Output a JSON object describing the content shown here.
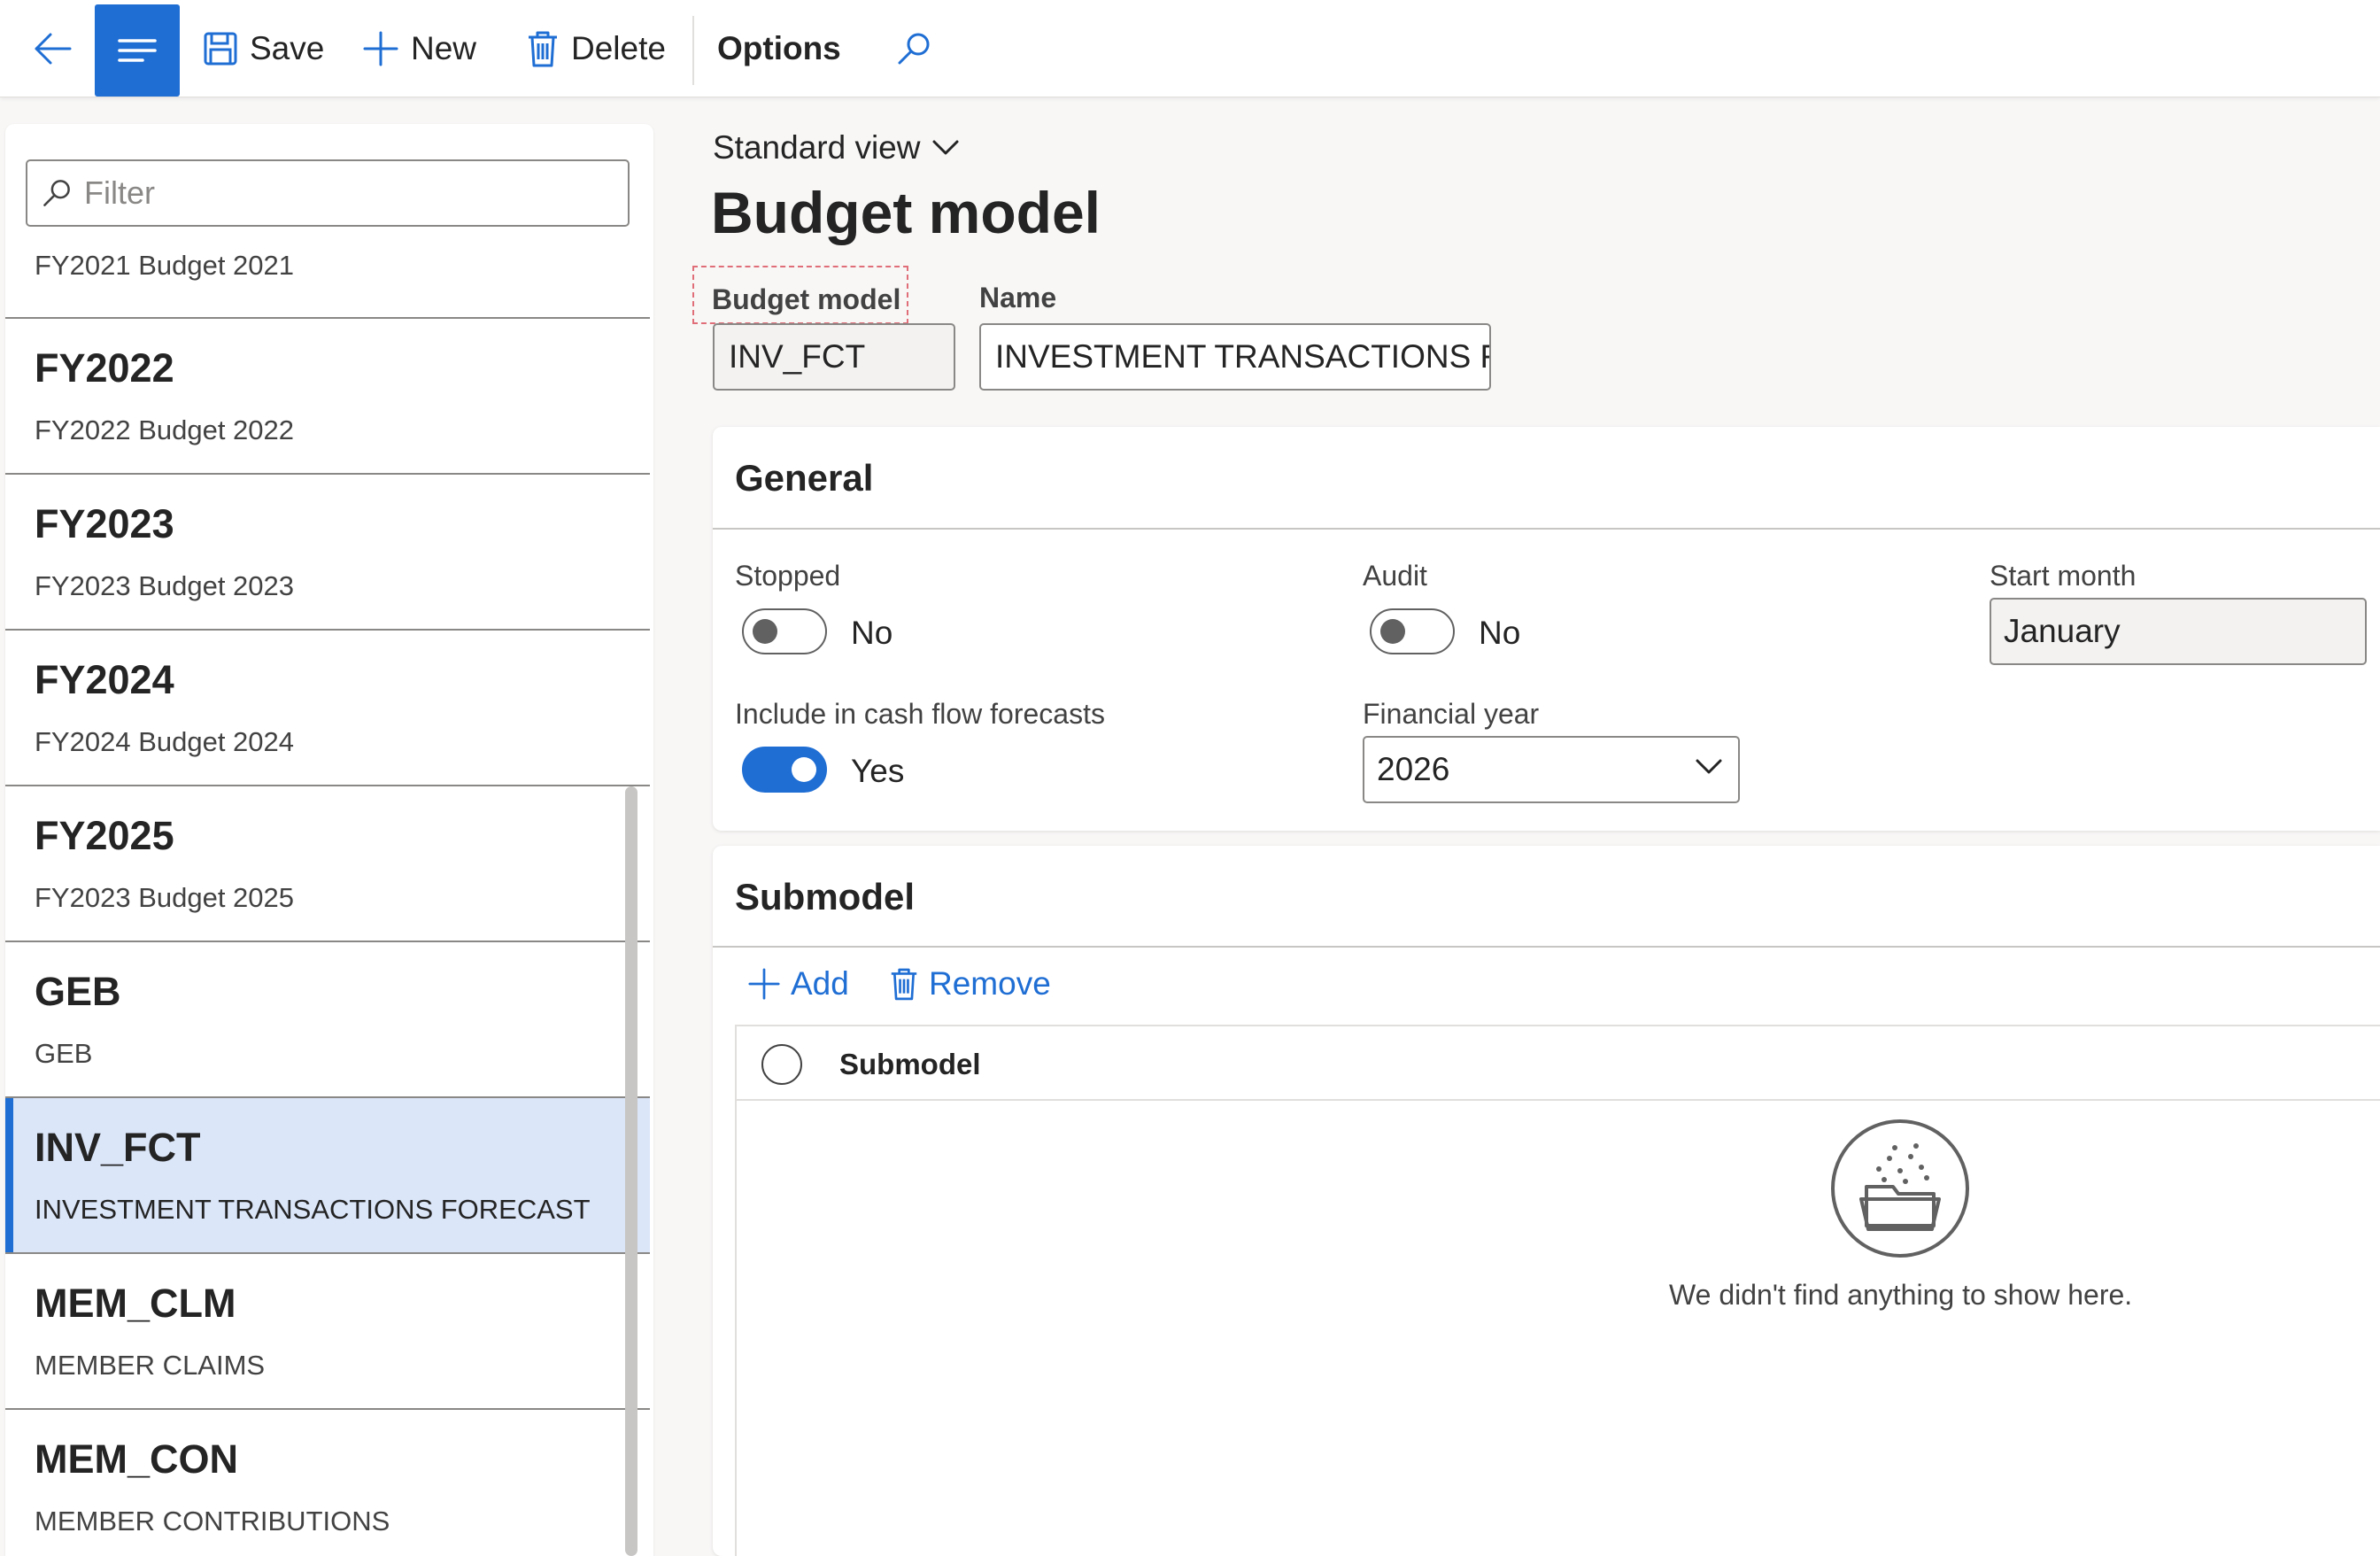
{
  "toolbar": {
    "save_label": "Save",
    "new_label": "New",
    "delete_label": "Delete",
    "options_label": "Options"
  },
  "list": {
    "filter_placeholder": "Filter",
    "first_item_partial_desc": "FY2021 Budget 2021",
    "items": [
      {
        "code": "FY2022",
        "desc": "FY2022 Budget 2022"
      },
      {
        "code": "FY2023",
        "desc": "FY2023 Budget 2023"
      },
      {
        "code": "FY2024",
        "desc": "FY2024 Budget 2024"
      },
      {
        "code": "FY2025",
        "desc": "FY2023 Budget 2025"
      },
      {
        "code": "GEB",
        "desc": "GEB"
      },
      {
        "code": "INV_FCT",
        "desc": "INVESTMENT TRANSACTIONS FORECAST",
        "selected": true
      },
      {
        "code": "MEM_CLM",
        "desc": "MEMBER CLAIMS"
      },
      {
        "code": "MEM_CON",
        "desc": "MEMBER CONTRIBUTIONS"
      }
    ]
  },
  "main": {
    "view_label": "Standard view",
    "title": "Budget model",
    "budget_model_label": "Budget model",
    "budget_model_value": "INV_FCT",
    "name_label": "Name",
    "name_value": "INVESTMENT TRANSACTIONS F..."
  },
  "general": {
    "header": "General",
    "stopped_label": "Stopped",
    "stopped_value": "No",
    "audit_label": "Audit",
    "audit_value": "No",
    "start_month_label": "Start month",
    "start_month_value": "January",
    "cash_flow_label": "Include in cash flow forecasts",
    "cash_flow_value": "Yes",
    "financial_year_label": "Financial year",
    "financial_year_value": "2026"
  },
  "submodel": {
    "header": "Submodel",
    "add_label": "Add",
    "remove_label": "Remove",
    "column_label": "Submodel",
    "empty_text": "We didn't find anything to show here."
  },
  "colors": {
    "accent": "#1f6ed4",
    "selected_row": "#dbe6f9",
    "highlight_border": "#e06e78"
  }
}
